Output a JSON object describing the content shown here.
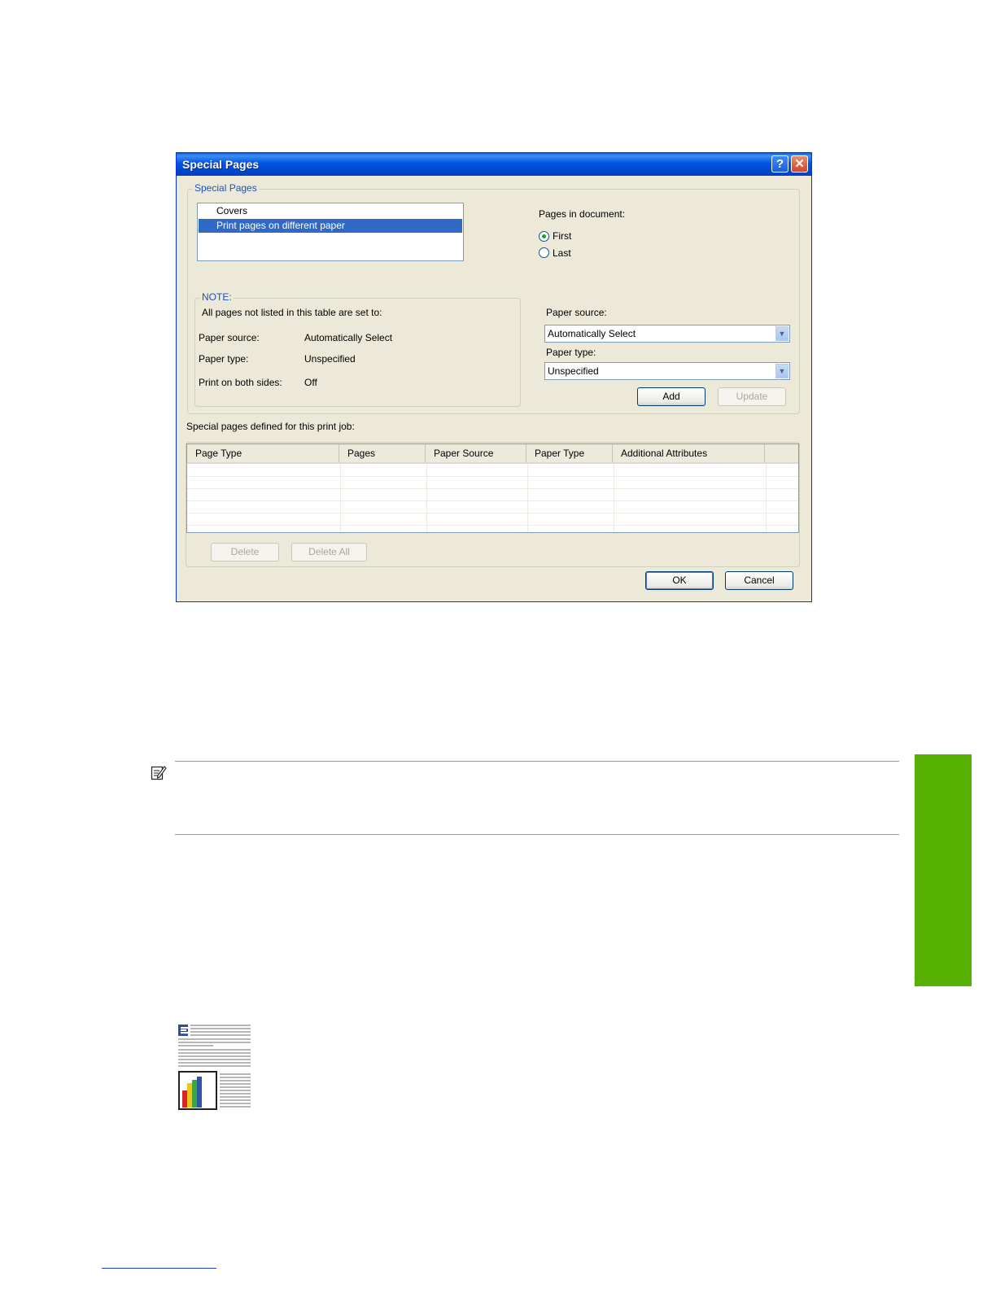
{
  "dialog": {
    "title": "Special Pages",
    "help_button": "?",
    "close_button": "✕",
    "special_pages_group": {
      "legend": "Special Pages",
      "list_items": [
        {
          "label": "Covers",
          "selected": false
        },
        {
          "label": "Print pages on different paper",
          "selected": true
        }
      ]
    },
    "pages_in_document": {
      "label": "Pages in document:",
      "options": [
        {
          "label": "First",
          "checked": true
        },
        {
          "label": "Last",
          "checked": false
        }
      ]
    },
    "note": {
      "legend": "NOTE:",
      "intro": "All pages not listed in this table are set to:",
      "rows": [
        {
          "label": "Paper source:",
          "value": "Automatically Select"
        },
        {
          "label": "Paper type:",
          "value": "Unspecified"
        },
        {
          "label": "Print on both sides:",
          "value": "Off"
        }
      ]
    },
    "paper_source": {
      "label": "Paper source:",
      "value": "Automatically Select"
    },
    "paper_type": {
      "label": "Paper type:",
      "value": "Unspecified"
    },
    "add_label": "Add",
    "update_label": "Update",
    "defined_label": "Special pages defined for this print job:",
    "table": {
      "columns": [
        "Page Type",
        "Pages",
        "Paper Source",
        "Paper Type",
        "Additional Attributes"
      ]
    },
    "delete_label": "Delete",
    "delete_all_label": "Delete All",
    "ok_label": "OK",
    "cancel_label": "Cancel"
  },
  "colors": {
    "accent_green": "#55b000",
    "rule_green": "#7cbb3a",
    "selection_blue": "#316ac5"
  },
  "icons": [
    "note-icon",
    "document-chart-icon"
  ]
}
